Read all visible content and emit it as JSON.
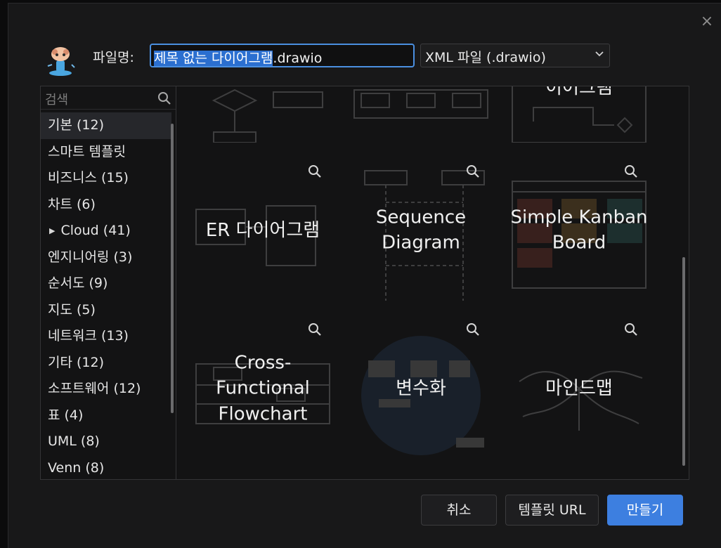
{
  "dialog": {
    "filename_label": "파일명:",
    "filename_selected": "제목 없는 다이어그램",
    "filename_ext": ".drawio",
    "format_selected": "XML 파일 (.drawio)",
    "close_icon": "close-icon"
  },
  "sidebar": {
    "search_placeholder": "검색",
    "categories": [
      {
        "label": "기본 (12)"
      },
      {
        "label": "스마트 템플릿"
      },
      {
        "label": "비즈니스 (15)"
      },
      {
        "label": "차트 (6)"
      },
      {
        "label": "Cloud (41)",
        "expandable": true
      },
      {
        "label": "엔지니어링 (3)"
      },
      {
        "label": "순서도 (9)"
      },
      {
        "label": "지도 (5)"
      },
      {
        "label": "네트워크 (13)"
      },
      {
        "label": "기타 (12)"
      },
      {
        "label": "소프트웨어 (12)"
      },
      {
        "label": "표 (4)"
      },
      {
        "label": "UML (8)"
      },
      {
        "label": "Venn (8)"
      }
    ]
  },
  "templates": {
    "partial_top_title": "이어그램",
    "row2": [
      "ER 다이어그램",
      "Sequence Diagram",
      "Simple Kanban Board"
    ],
    "row3": [
      "Cross-Functional Flowchart",
      "변수화",
      "마인드맵"
    ]
  },
  "buttons": {
    "cancel": "취소",
    "template_url": "템플릿 URL",
    "create": "만들기"
  },
  "colors": {
    "accent": "#3d7fe0",
    "background": "#181819"
  }
}
